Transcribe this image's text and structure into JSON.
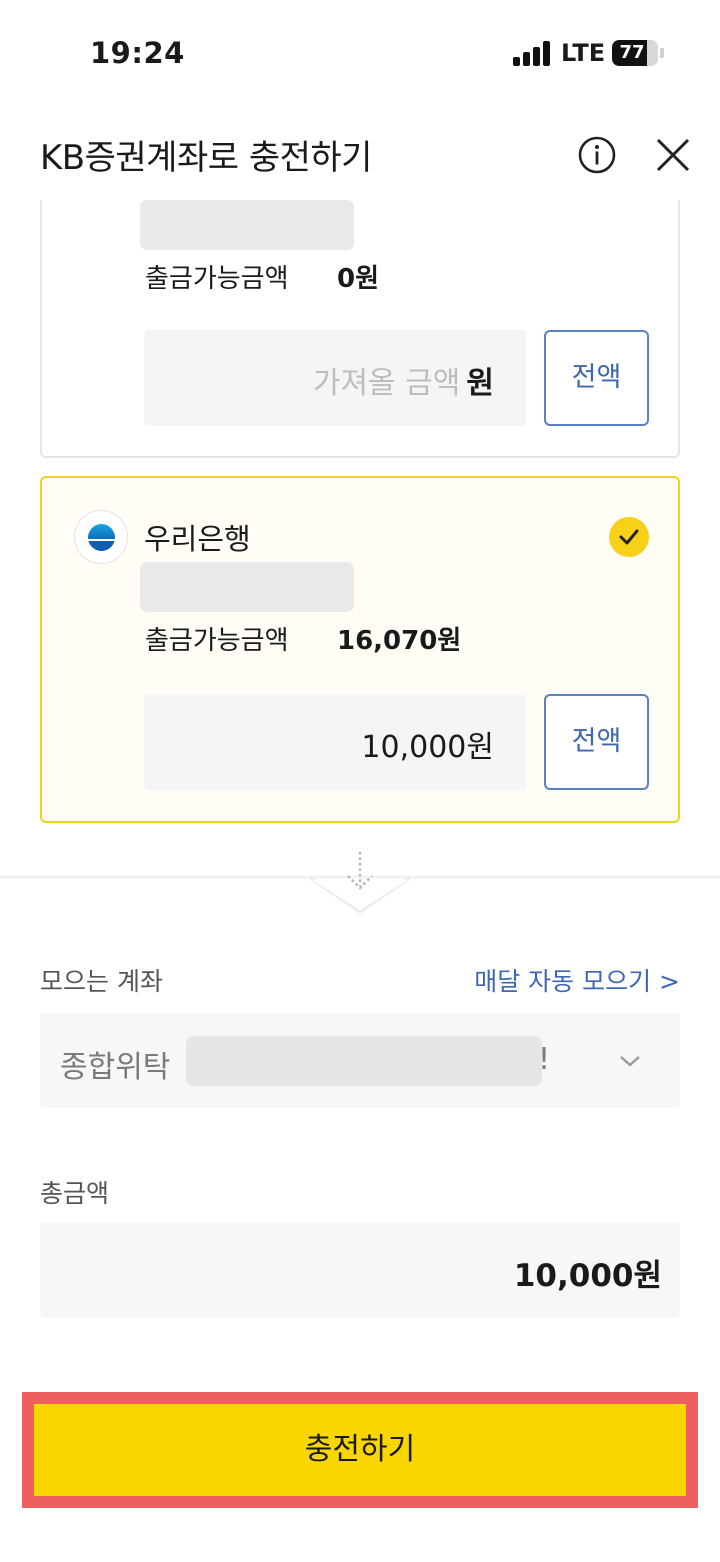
{
  "status_bar": {
    "time": "19:24",
    "network": "LTE",
    "battery": "77",
    "battery_level": 0.77
  },
  "header": {
    "title": "KB증권계좌로 충전하기",
    "info_icon": "info-icon",
    "close_icon": "close-icon"
  },
  "source_accounts": [
    {
      "bank_name": "",
      "account_number_masked": true,
      "available_label": "출금가능금액",
      "available_value": "0원",
      "amount_placeholder": "가져올 금액",
      "amount_unit": "원",
      "full_button": "전액",
      "selected": false
    },
    {
      "bank_name": "우리은행",
      "account_number_masked": true,
      "available_label": "출금가능금액",
      "available_value": "16,070원",
      "amount_value": "10,000원",
      "full_button": "전액",
      "selected": true
    }
  ],
  "target": {
    "label": "모으는 계좌",
    "auto_link": "매달 자동 모으기 >",
    "account_prefix": "종합위탁",
    "account_tail": "!"
  },
  "total": {
    "label": "총금액",
    "value": "10,000원"
  },
  "charge_button": "충전하기",
  "colors": {
    "accent_yellow": "#f9d600",
    "link_blue": "#3d66b4",
    "highlight_red": "#f05f5f"
  }
}
